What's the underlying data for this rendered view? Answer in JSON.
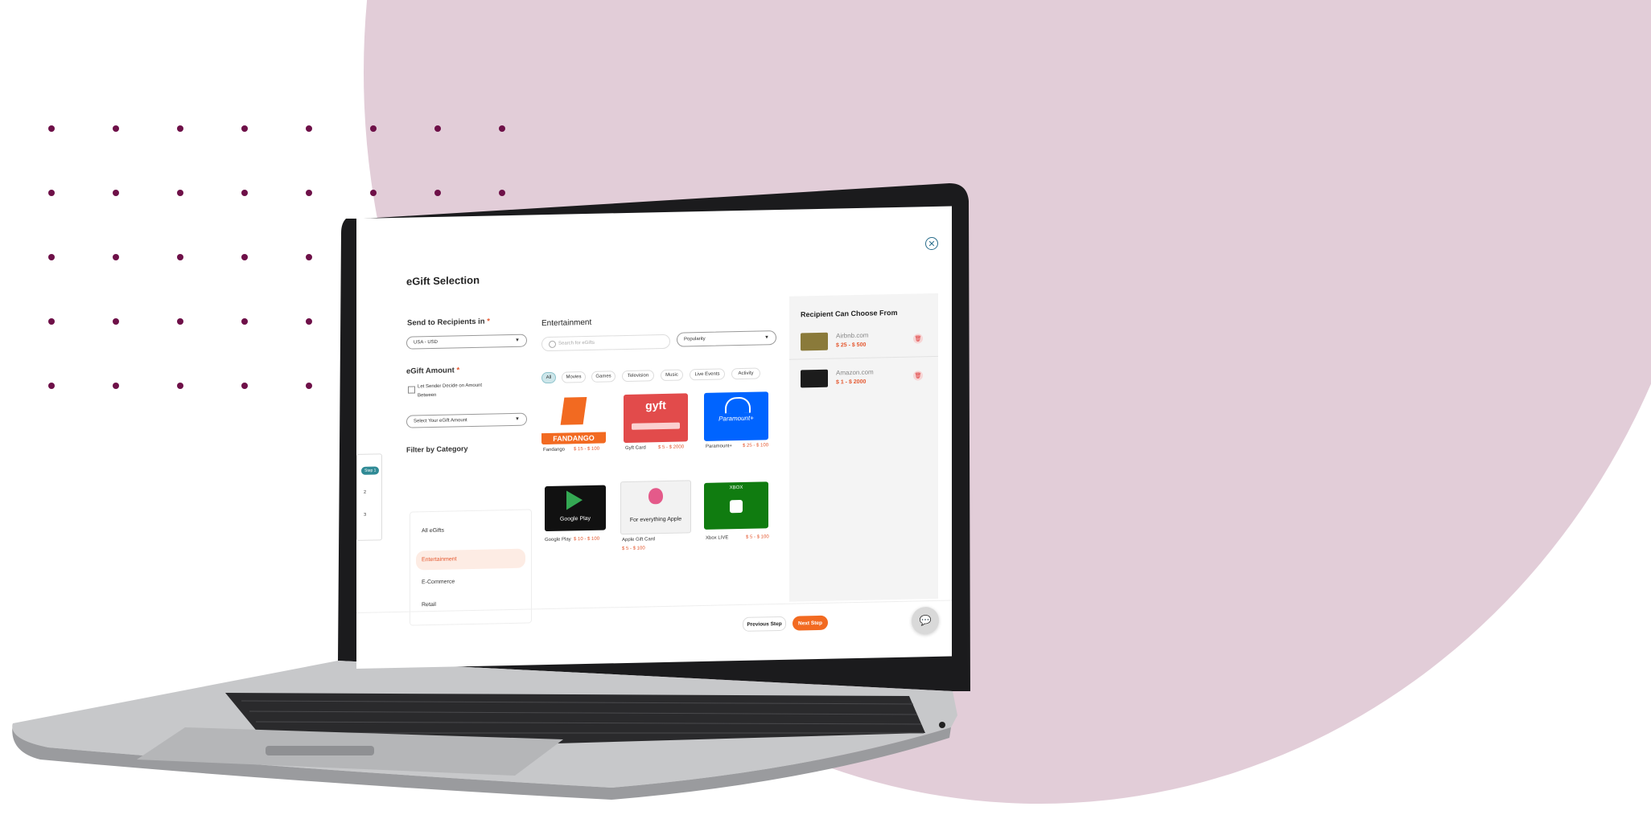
{
  "colors": {
    "background_circle": "#e2cdd8",
    "dot": "#6e1048",
    "accent_orange": "#f26a21",
    "teal": "#2f8a95"
  },
  "modal": {
    "title": "eGift Selection",
    "send_to_label": "Send to Recipients in",
    "country_value": "USA - USD",
    "amount_label": "eGift Amount",
    "sender_decide_label": "Let Sender Decide on Amount Between",
    "amount_select_placeholder": "Select Your eGift Amount",
    "filter_label": "Filter by Category",
    "categories": [
      "All eGifts",
      "Entertainment",
      "E-Commerce",
      "Retail"
    ],
    "active_category": "Entertainment"
  },
  "steps": {
    "current": "Step 1",
    "others": [
      "2",
      "3"
    ]
  },
  "catalog": {
    "section_title": "Entertainment",
    "search_placeholder": "Search for eGifts",
    "sort_value": "Popularity",
    "filters": [
      "All",
      "Movies",
      "Games",
      "Television",
      "Music",
      "Live Events",
      "Activity"
    ],
    "active_filter": "All",
    "cards": [
      {
        "name": "Fandango",
        "price": "$ 15 - $ 100",
        "logo_text": "FANDANGO",
        "color": "#f26a21"
      },
      {
        "name": "Gyft Card",
        "price": "$ 5 - $ 2000",
        "logo_text": "gyft",
        "color": "#e24b4b"
      },
      {
        "name": "Paramount+",
        "price": "$ 25 - $ 100",
        "logo_text": "Paramount+",
        "color": "#0064ff"
      },
      {
        "name": "Google Play",
        "price": "$ 10 - $ 100",
        "logo_text": "Google Play",
        "color": "#111111"
      },
      {
        "name": "Apple Gift Card",
        "price": "$ 5 - $ 100",
        "logo_text": "For everything Apple",
        "color": "#f2f2f2"
      },
      {
        "name": "Xbox LIVE",
        "price": "$ 5 - $ 100",
        "logo_text": "XBOX",
        "color": "#107c10"
      }
    ]
  },
  "recipient_panel": {
    "title": "Recipient Can Choose From",
    "items": [
      {
        "name": "Airbnb.com",
        "price": "$ 25 - $ 500"
      },
      {
        "name": "Amazon.com",
        "price": "$ 1 - $ 2000"
      }
    ]
  },
  "footer": {
    "previous_label": "Previous Step",
    "next_label": "Next Step"
  }
}
